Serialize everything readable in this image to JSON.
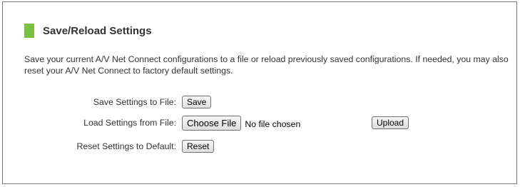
{
  "page": {
    "title": "Save/Reload Settings",
    "accent_color": "#7ac142",
    "description": "Save your current A/V Net Connect configurations to a file or reload previously saved configurations. If needed, you may also reset your A/V Net Connect to factory default settings."
  },
  "rows": {
    "save": {
      "label": "Save Settings to File:",
      "button": "Save"
    },
    "load": {
      "label": "Load Settings from File:",
      "choose_button": "Choose File",
      "file_status": "No file chosen",
      "upload_button": "Upload"
    },
    "reset": {
      "label": "Reset Settings to Default:",
      "button": "Reset"
    }
  }
}
